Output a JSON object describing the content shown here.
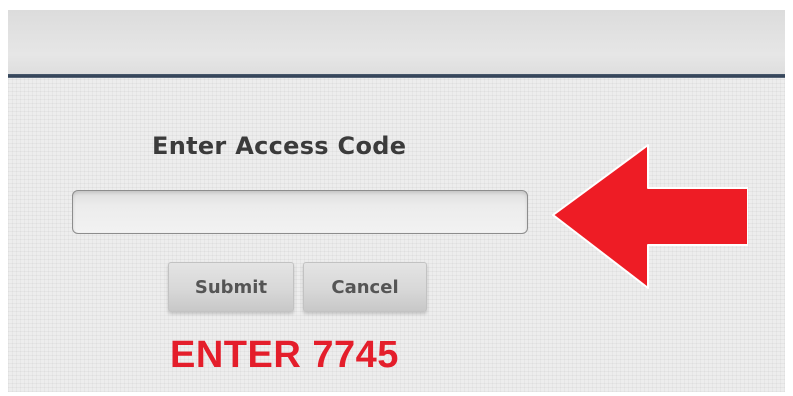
{
  "dialog": {
    "title": "Enter Access Code",
    "input_value": "",
    "input_placeholder": "",
    "submit_label": "Submit",
    "cancel_label": "Cancel"
  },
  "annotation": {
    "instruction": "ENTER 7745",
    "arrow_icon": "left-arrow-icon",
    "accent_color": "#e41e2b"
  }
}
